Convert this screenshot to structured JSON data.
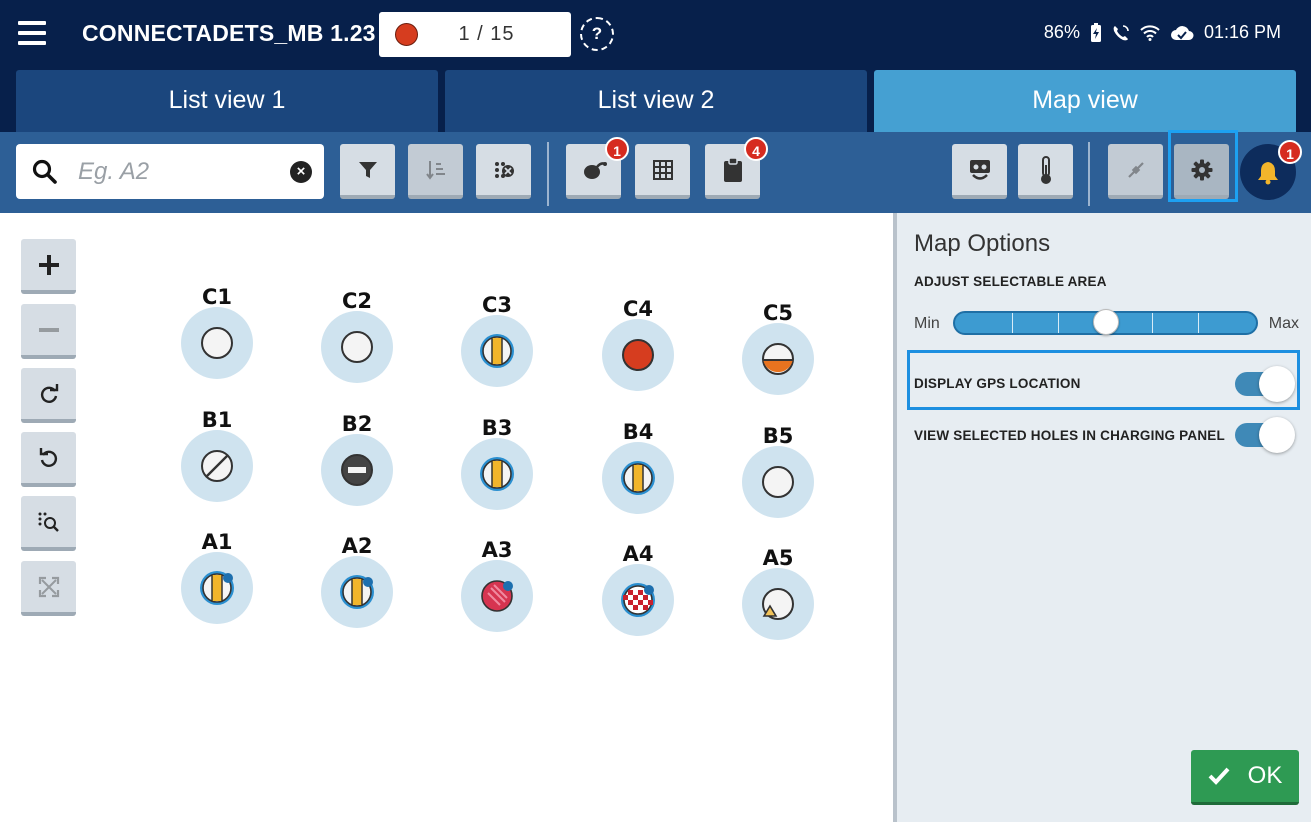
{
  "header": {
    "menu_icon": "hamburger-menu-icon",
    "app_title": "CONNECTADETS_MB 1.23",
    "counter_text": "1 / 15",
    "counter_dot_color": "#d63d1f",
    "help_icon": "help-icon",
    "status": {
      "battery": "86%",
      "time": "01:16 PM"
    }
  },
  "tabs": [
    {
      "label": "List view 1",
      "active": false
    },
    {
      "label": "List view 2",
      "active": false
    },
    {
      "label": "Map view",
      "active": true
    }
  ],
  "toolbar": {
    "search_placeholder": "Eg. A2",
    "badges": {
      "charge": "1",
      "clipboard": "4",
      "bell": "1"
    }
  },
  "map": {
    "rows": [
      [
        "C1",
        "C2",
        "C3",
        "C4",
        "C5"
      ],
      [
        "B1",
        "B2",
        "B3",
        "B4",
        "B5"
      ],
      [
        "A1",
        "A2",
        "A3",
        "A4",
        "A5"
      ]
    ]
  },
  "panel": {
    "title": "Map Options",
    "adjust_label": "ADJUST SELECTABLE AREA",
    "slider_min": "Min",
    "slider_max": "Max",
    "slider_level": 0.5,
    "gps_label": "DISPLAY GPS LOCATION",
    "gps_enabled": true,
    "view_selected_label": "VIEW SELECTED HOLES IN CHARGING PANEL",
    "view_selected_enabled": true,
    "ok_label": "OK"
  },
  "colors": {
    "header_bg": "#07204b",
    "tab_active": "#45a0d2",
    "tab_inactive": "#1b467d",
    "toolbar_bg": "#2d5f96",
    "hole_ring": "#cfe3ef",
    "ok_green": "#2e9a53",
    "highlight_blue": "#1d8fe0"
  }
}
